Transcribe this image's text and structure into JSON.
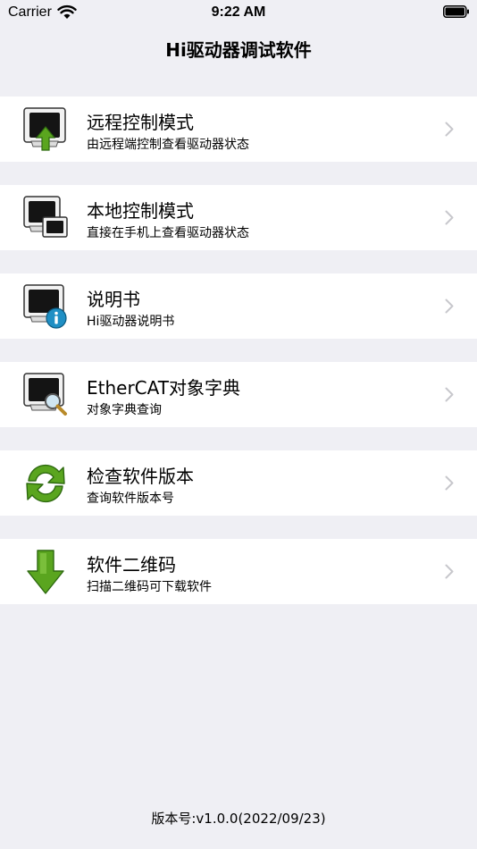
{
  "status_bar": {
    "carrier": "Carrier",
    "time": "9:22 AM"
  },
  "nav": {
    "title": "Hi驱动器调试软件"
  },
  "menu": {
    "items": [
      {
        "title": "远程控制模式",
        "subtitle": "由远程端控制查看驱动器状态",
        "icon": "monitor-upload-icon"
      },
      {
        "title": "本地控制模式",
        "subtitle": "直接在手机上查看驱动器状态",
        "icon": "monitor-local-icon"
      },
      {
        "title": "说明书",
        "subtitle": "Hi驱动器说明书",
        "icon": "monitor-info-icon"
      },
      {
        "title": "EtherCAT对象字典",
        "subtitle": "对象字典查询",
        "icon": "monitor-search-icon"
      },
      {
        "title": "检查软件版本",
        "subtitle": "查询软件版本号",
        "icon": "refresh-icon"
      },
      {
        "title": "软件二维码",
        "subtitle": "扫描二维码可下载软件",
        "icon": "download-arrow-icon"
      }
    ]
  },
  "footer": {
    "version": "版本号:v1.0.0(2022/09/23)"
  },
  "colors": {
    "background": "#efeff4",
    "row_background": "#ffffff",
    "chevron": "#c7c7cc",
    "accent_green": "#5aa51f",
    "info_blue": "#1f8fc4"
  }
}
